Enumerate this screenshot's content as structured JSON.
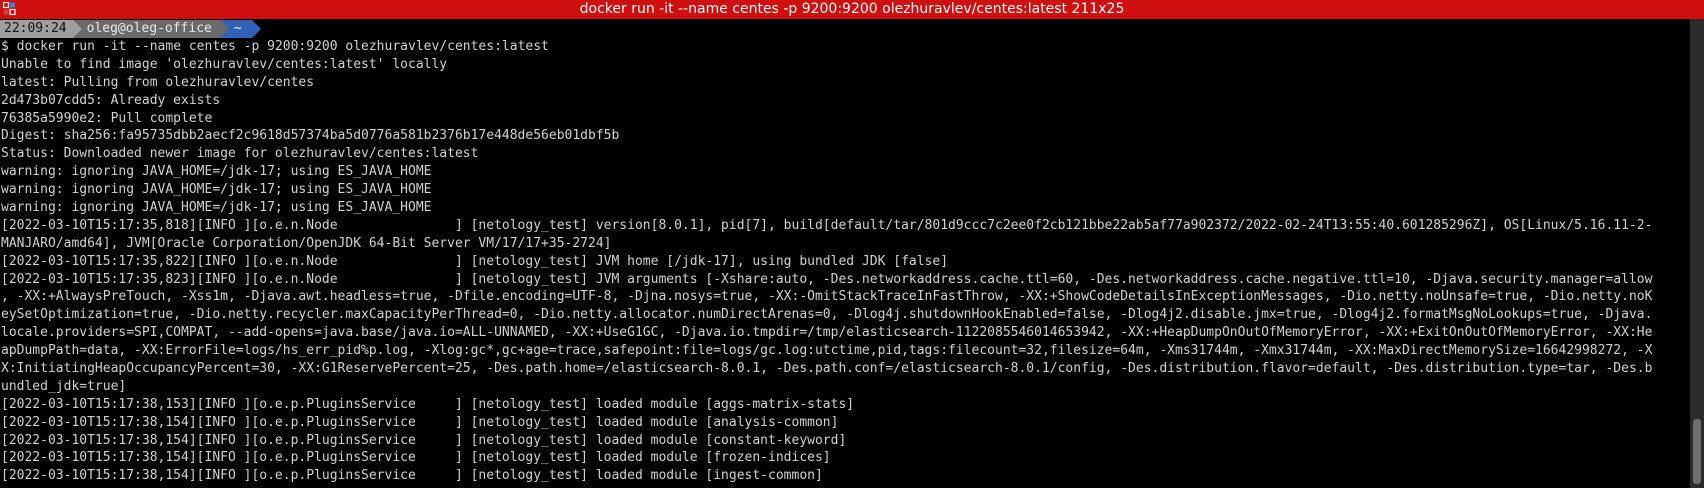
{
  "window": {
    "title": "docker run -it --name centes -p 9200:9200 olezhuravlev/centes:latest 211x25",
    "app_icon": "terminal-app-icon",
    "titlebar_color": "#cf0e0e"
  },
  "prompt": {
    "time": "22:09:24",
    "user_host": "oleg@oleg-office",
    "directory": "~",
    "dir_color": "#2f63b8"
  },
  "terminal": {
    "command_prefix": "$ ",
    "command": "docker run -it --name centes -p 9200:9200 olezhuravlev/centes:latest",
    "output": [
      "Unable to find image 'olezhuravlev/centes:latest' locally",
      "latest: Pulling from olezhuravlev/centes",
      "2d473b07cdd5: Already exists",
      "76385a5990e2: Pull complete",
      "Digest: sha256:fa95735dbb2aecf2c9618d57374ba5d0776a581b2376b17e448de56eb01dbf5b",
      "Status: Downloaded newer image for olezhuravlev/centes:latest",
      "warning: ignoring JAVA_HOME=/jdk-17; using ES_JAVA_HOME",
      "warning: ignoring JAVA_HOME=/jdk-17; using ES_JAVA_HOME",
      "warning: ignoring JAVA_HOME=/jdk-17; using ES_JAVA_HOME",
      "[2022-03-10T15:17:35,818][INFO ][o.e.n.Node               ] [netology_test] version[8.0.1], pid[7], build[default/tar/801d9ccc7c2ee0f2cb121bbe22ab5af77a902372/2022-02-24T13:55:40.601285296Z], OS[Linux/5.16.11-2-",
      "MANJARO/amd64], JVM[Oracle Corporation/OpenJDK 64-Bit Server VM/17/17+35-2724]",
      "[2022-03-10T15:17:35,822][INFO ][o.e.n.Node               ] [netology_test] JVM home [/jdk-17], using bundled JDK [false]",
      "[2022-03-10T15:17:35,823][INFO ][o.e.n.Node               ] [netology_test] JVM arguments [-Xshare:auto, -Des.networkaddress.cache.ttl=60, -Des.networkaddress.cache.negative.ttl=10, -Djava.security.manager=allow",
      ", -XX:+AlwaysPreTouch, -Xss1m, -Djava.awt.headless=true, -Dfile.encoding=UTF-8, -Djna.nosys=true, -XX:-OmitStackTraceInFastThrow, -XX:+ShowCodeDetailsInExceptionMessages, -Dio.netty.noUnsafe=true, -Dio.netty.noK",
      "eySetOptimization=true, -Dio.netty.recycler.maxCapacityPerThread=0, -Dio.netty.allocator.numDirectArenas=0, -Dlog4j.shutdownHookEnabled=false, -Dlog4j2.disable.jmx=true, -Dlog4j2.formatMsgNoLookups=true, -Djava.",
      "locale.providers=SPI,COMPAT, --add-opens=java.base/java.io=ALL-UNNAMED, -XX:+UseG1GC, -Djava.io.tmpdir=/tmp/elasticsearch-1122085546014653942, -XX:+HeapDumpOnOutOfMemoryError, -XX:+ExitOnOutOfMemoryError, -XX:He",
      "apDumpPath=data, -XX:ErrorFile=logs/hs_err_pid%p.log, -Xlog:gc*,gc+age=trace,safepoint:file=logs/gc.log:utctime,pid,tags:filecount=32,filesize=64m, -Xms31744m, -Xmx31744m, -XX:MaxDirectMemorySize=16642998272, -X",
      "X:InitiatingHeapOccupancyPercent=30, -XX:G1ReservePercent=25, -Des.path.home=/elasticsearch-8.0.1, -Des.path.conf=/elasticsearch-8.0.1/config, -Des.distribution.flavor=default, -Des.distribution.type=tar, -Des.b",
      "undled_jdk=true]",
      "[2022-03-10T15:17:38,153][INFO ][o.e.p.PluginsService     ] [netology_test] loaded module [aggs-matrix-stats]",
      "[2022-03-10T15:17:38,154][INFO ][o.e.p.PluginsService     ] [netology_test] loaded module [analysis-common]",
      "[2022-03-10T15:17:38,154][INFO ][o.e.p.PluginsService     ] [netology_test] loaded module [constant-keyword]",
      "[2022-03-10T15:17:38,154][INFO ][o.e.p.PluginsService     ] [netology_test] loaded module [frozen-indices]",
      "[2022-03-10T15:17:38,154][INFO ][o.e.p.PluginsService     ] [netology_test] loaded module [ingest-common]"
    ]
  }
}
